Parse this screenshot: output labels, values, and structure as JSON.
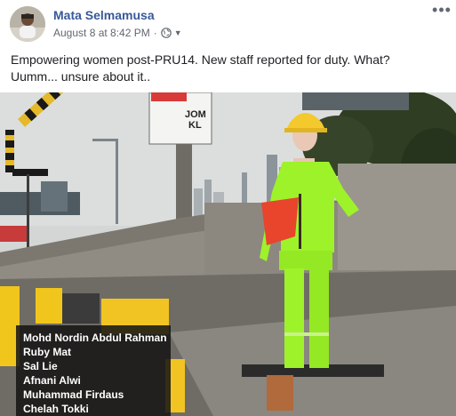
{
  "post": {
    "author": "Mata Selmamusa",
    "date": "August 8 at 8:42 PM",
    "separator": "·",
    "privacy_icon": "globe-icon",
    "dropdown_icon": "caret-down-icon",
    "more_icon": "more-options-icon",
    "more_glyph": "•••",
    "text_line1": "Empowering women post-PRU14. New staff reported for duty. What?",
    "text_line2": "Uumm... unsure about it.."
  },
  "photo": {
    "sign_text_1": "JOM",
    "sign_text_2": "KL",
    "tags": [
      "Mohd Nordin Abdul Rahman",
      "Ruby Mat",
      "Sal Lie",
      "Afnani Alwi",
      "Muhammad Firdaus",
      "Chelah Tokki"
    ]
  },
  "colors": {
    "author_link": "#385898",
    "meta_text": "#616770",
    "body_text": "#1c1e21",
    "vest": "#9ef22a",
    "flag": "#e8452c"
  }
}
